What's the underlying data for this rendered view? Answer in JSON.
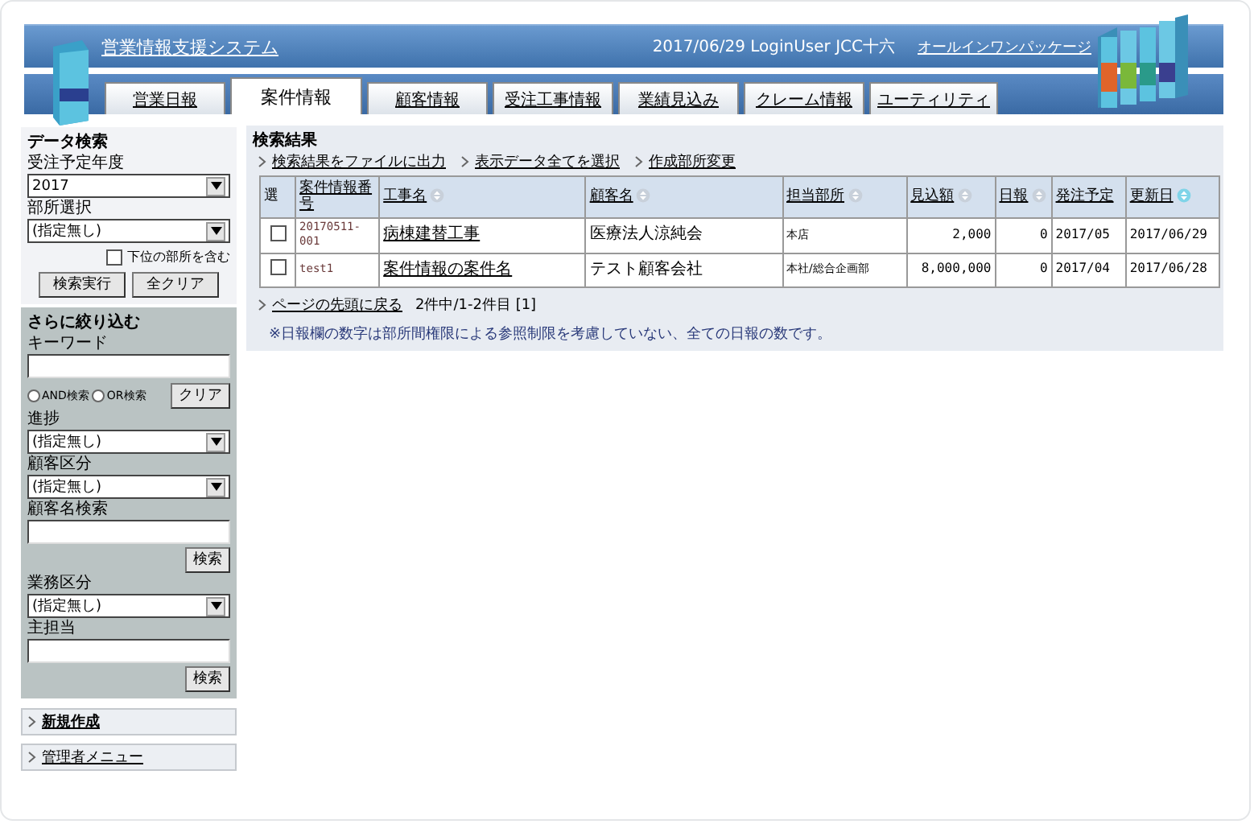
{
  "header": {
    "title": "営業情報支援システム",
    "info": "2017/06/29 LoginUser JCC十六",
    "package_link": "オールインワンパッケージ"
  },
  "tabs": [
    {
      "label": "営業日報",
      "selected": false
    },
    {
      "label": "案件情報",
      "selected": true
    },
    {
      "label": "顧客情報",
      "selected": false
    },
    {
      "label": "受注工事情報",
      "selected": false
    },
    {
      "label": "業績見込み",
      "selected": false
    },
    {
      "label": "クレーム情報",
      "selected": false
    },
    {
      "label": "ユーティリティ",
      "selected": false
    }
  ],
  "sidebar": {
    "search": {
      "title": "データ検索",
      "items": [
        {
          "kind": "label",
          "text": "受注予定年度"
        },
        {
          "kind": "select",
          "value": "2017"
        },
        {
          "kind": "label",
          "text": "部所選択"
        },
        {
          "kind": "select",
          "value": "(指定無し)"
        },
        {
          "kind": "checkbox",
          "text": "下位の部所を含む",
          "checked": false
        },
        {
          "kind": "buttons",
          "buttons": [
            "検索実行",
            "全クリア"
          ]
        }
      ]
    },
    "refine": {
      "title": "さらに絞り込む",
      "items": [
        {
          "kind": "label",
          "text": "キーワード"
        },
        {
          "kind": "input"
        },
        {
          "kind": "radios",
          "options": [
            {
              "text": "AND検索",
              "selected": false
            },
            {
              "text": "OR検索",
              "selected": false
            }
          ],
          "button": "クリア"
        },
        {
          "kind": "label",
          "text": "進捗"
        },
        {
          "kind": "select",
          "value": "(指定無し)"
        },
        {
          "kind": "label",
          "text": "顧客区分"
        },
        {
          "kind": "select",
          "value": "(指定無し)"
        },
        {
          "kind": "label",
          "text": "顧客名検索"
        },
        {
          "kind": "input"
        },
        {
          "kind": "button",
          "text": "検索"
        },
        {
          "kind": "label",
          "text": "業務区分"
        },
        {
          "kind": "select",
          "value": "(指定無し)"
        },
        {
          "kind": "label",
          "text": "主担当"
        },
        {
          "kind": "input"
        },
        {
          "kind": "button",
          "text": "検索"
        }
      ]
    },
    "links": [
      {
        "label": "新規作成",
        "bold": true
      },
      {
        "label": "管理者メニュー",
        "bold": false
      }
    ]
  },
  "results": {
    "title": "検索結果",
    "actions": [
      "検索結果をファイルに出力",
      "表示データ全てを選択",
      "作成部所変更"
    ],
    "columns": [
      {
        "label": "選",
        "link": false,
        "sortable": false
      },
      {
        "label": "案件情報番号",
        "link": true,
        "sortable": false
      },
      {
        "label": "工事名",
        "link": true,
        "sortable": true,
        "sorted": false
      },
      {
        "label": "顧客名",
        "link": true,
        "sortable": true,
        "sorted": false
      },
      {
        "label": "担当部所",
        "link": true,
        "sortable": true,
        "sorted": false
      },
      {
        "label": "見込額",
        "link": true,
        "sortable": true,
        "sorted": false
      },
      {
        "label": "日報",
        "link": true,
        "sortable": true,
        "sorted": false
      },
      {
        "label": "発注予定",
        "link": true,
        "sortable": false
      },
      {
        "label": "更新日",
        "link": true,
        "sortable": true,
        "sorted": true
      }
    ],
    "rows": [
      {
        "checked": false,
        "number": "20170511-001",
        "name": "病棟建替工事",
        "customer": "医療法人涼純会",
        "department": "本店",
        "amount": "2,000",
        "reports": "0",
        "order_month": "2017/05",
        "updated": "2017/06/29"
      },
      {
        "checked": false,
        "number": "test1",
        "name": "案件情報の案件名",
        "customer": "テスト顧客会社",
        "department": "本社/総合企画部",
        "amount": "8,000,000",
        "reports": "0",
        "order_month": "2017/04",
        "updated": "2017/06/28"
      }
    ],
    "back_link": "ページの先頭に戻る",
    "count": "2件中/1-2件目 [1]",
    "note": "※日報欄の数字は部所間権限による参照制限を考慮していない、全ての日報の数です。"
  }
}
